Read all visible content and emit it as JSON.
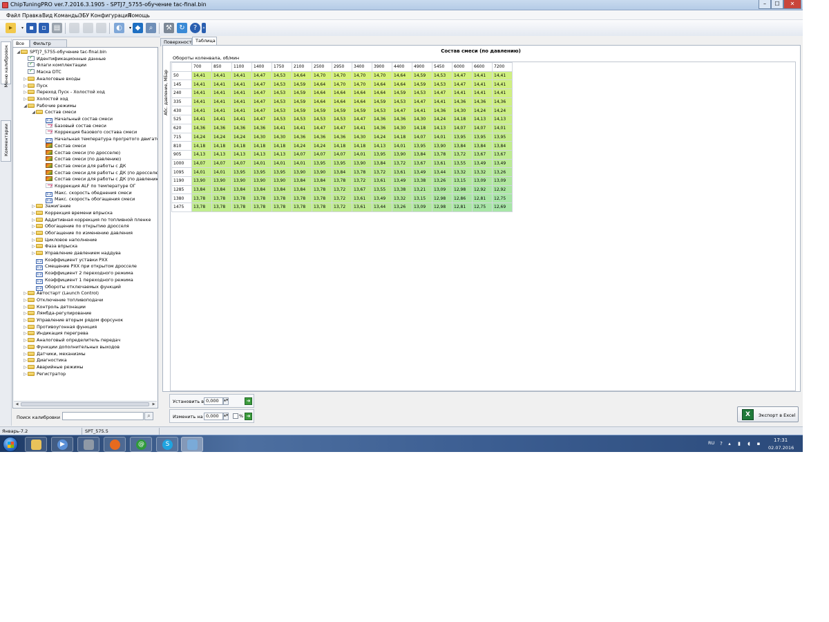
{
  "window": {
    "title": "ChipTuningPRO ver.7.2016.3.1905 - SPTJ7_5755-обучение  tac-final.bin",
    "min_glyph": "–",
    "max_glyph": "☐",
    "close_glyph": "✕"
  },
  "menu": [
    "Файл",
    "Правка",
    "Вид",
    "Команды",
    "ЭБУ",
    "Конфигурация",
    "Помощь"
  ],
  "sidetabs": {
    "menu": "Меню калибровок",
    "comments": "Комментарии"
  },
  "lefttabs": {
    "all": "Все",
    "filter": "Фильтр"
  },
  "tree": [
    {
      "label": "SPTJ7_5755-обучение  tac-final.bin",
      "level": 0,
      "icon": "folder",
      "exp": "◢"
    },
    {
      "label": "Идентификационные данные",
      "level": 1,
      "icon": "doc-check",
      "exp": ""
    },
    {
      "label": "Флаги комплектации",
      "level": 1,
      "icon": "doc-check",
      "exp": ""
    },
    {
      "label": "Маска DTC",
      "level": 1,
      "icon": "doc-check",
      "exp": ""
    },
    {
      "label": "Аналоговые входы",
      "level": 1,
      "icon": "folder",
      "exp": "▷"
    },
    {
      "label": "Пуск",
      "level": 1,
      "icon": "folder",
      "exp": "▷"
    },
    {
      "label": "Переход Пуск - Холостой ход",
      "level": 1,
      "icon": "folder",
      "exp": "▷"
    },
    {
      "label": "Холостой ход",
      "level": 1,
      "icon": "folder",
      "exp": "▷"
    },
    {
      "label": "Рабочие режимы",
      "level": 1,
      "icon": "folder",
      "exp": "◢"
    },
    {
      "label": "Состав смеси",
      "level": 2,
      "icon": "folder",
      "exp": "◢"
    },
    {
      "label": "Начальный состав смеси",
      "level": 3,
      "icon": "num",
      "exp": ""
    },
    {
      "label": "Базовый состав смеси",
      "level": 3,
      "icon": "curve",
      "exp": ""
    },
    {
      "label": "Коррекция базового состава смеси",
      "level": 3,
      "icon": "curve",
      "exp": ""
    },
    {
      "label": "Начальная температура прогретого двигателя",
      "level": 3,
      "icon": "num",
      "exp": ""
    },
    {
      "label": "Состав смеси",
      "level": 3,
      "icon": "map3d",
      "exp": ""
    },
    {
      "label": "Состав смеси (по дросселю)",
      "level": 3,
      "icon": "map3d",
      "exp": ""
    },
    {
      "label": "Состав смеси (по давлению)",
      "level": 3,
      "icon": "map3d",
      "exp": ""
    },
    {
      "label": "Состав смеси для работы с ДК",
      "level": 3,
      "icon": "map3d",
      "exp": ""
    },
    {
      "label": "Состав смеси для работы с ДК (по дросселю)",
      "level": 3,
      "icon": "map3d",
      "exp": ""
    },
    {
      "label": "Состав смеси для работы с ДК (по давлению)",
      "level": 3,
      "icon": "map3d",
      "exp": ""
    },
    {
      "label": "Коррекция ALF по температуре ОГ",
      "level": 3,
      "icon": "curve",
      "exp": ""
    },
    {
      "label": "Макс. скорость обеднения смеси",
      "level": 3,
      "icon": "num",
      "exp": ""
    },
    {
      "label": "Макс. скорость обогащения смеси",
      "level": 3,
      "icon": "num",
      "exp": ""
    },
    {
      "label": "Зажигание",
      "level": 2,
      "icon": "folder",
      "exp": "▷"
    },
    {
      "label": "Коррекция времени впрыска",
      "level": 2,
      "icon": "folder",
      "exp": "▷"
    },
    {
      "label": "Аддитивная коррекция по топливной пленке",
      "level": 2,
      "icon": "folder",
      "exp": "▷"
    },
    {
      "label": "Обогащение по открытию дросселя",
      "level": 2,
      "icon": "folder",
      "exp": "▷"
    },
    {
      "label": "Обогащение по изменению давления",
      "level": 2,
      "icon": "folder",
      "exp": "▷"
    },
    {
      "label": "Цикловое наполнение",
      "level": 2,
      "icon": "folder",
      "exp": "▷"
    },
    {
      "label": "Фаза впрыска",
      "level": 2,
      "icon": "folder",
      "exp": "▷"
    },
    {
      "label": "Управление давлением наддува",
      "level": 2,
      "icon": "folder",
      "exp": "▷"
    },
    {
      "label": "Коэффициент уставки РХХ",
      "level": 2,
      "icon": "num",
      "exp": ""
    },
    {
      "label": "Смещение РХХ при открытом дросселе",
      "level": 2,
      "icon": "num",
      "exp": ""
    },
    {
      "label": "Коэффициент 2 переходного режима",
      "level": 2,
      "icon": "num",
      "exp": ""
    },
    {
      "label": "Коэффициент 1 переходного режима",
      "level": 2,
      "icon": "num",
      "exp": ""
    },
    {
      "label": "Обороты отключаемых функций",
      "level": 2,
      "icon": "num",
      "exp": ""
    },
    {
      "label": "Автостарт (Launch Control)",
      "level": 1,
      "icon": "folder",
      "exp": "▷"
    },
    {
      "label": "Отключение топливоподачи",
      "level": 1,
      "icon": "folder",
      "exp": "▷"
    },
    {
      "label": "Контроль детонации",
      "level": 1,
      "icon": "folder",
      "exp": "▷"
    },
    {
      "label": "Лямбда-регулирование",
      "level": 1,
      "icon": "folder",
      "exp": "▷"
    },
    {
      "label": "Управление вторым рядом форсунок",
      "level": 1,
      "icon": "folder",
      "exp": "▷"
    },
    {
      "label": "Противоугонная функция",
      "level": 1,
      "icon": "folder",
      "exp": "▷"
    },
    {
      "label": "Индикация перегрева",
      "level": 1,
      "icon": "folder",
      "exp": "▷"
    },
    {
      "label": "Аналоговый определитель передач",
      "level": 1,
      "icon": "folder",
      "exp": "▷"
    },
    {
      "label": "Функции дополнительных выходов",
      "level": 1,
      "icon": "folder",
      "exp": "▷"
    },
    {
      "label": "Датчики, механизмы",
      "level": 1,
      "icon": "folder",
      "exp": "▷"
    },
    {
      "label": "Диагностика",
      "level": 1,
      "icon": "folder",
      "exp": "▷"
    },
    {
      "label": "Аварийные режимы",
      "level": 1,
      "icon": "folder",
      "exp": "▷"
    },
    {
      "label": "Регистратор",
      "level": 1,
      "icon": "folder",
      "exp": "▷"
    }
  ],
  "search": {
    "label": "Поиск калибровки",
    "value": "",
    "button_glyph": "⌕"
  },
  "righttabs": {
    "surface": "Поверхность",
    "table": "Таблица"
  },
  "table": {
    "title": "Состав смеси (по давлению)",
    "x_label": "Обороты коленвала, об/мин",
    "y_label": "Абс. давление, МБар",
    "columns": [
      "700",
      "850",
      "1100",
      "1400",
      "1750",
      "2100",
      "2500",
      "2950",
      "3400",
      "3900",
      "4400",
      "4900",
      "5450",
      "6000",
      "6600",
      "7200"
    ],
    "rows": [
      {
        "label": "50",
        "values": [
          "14,41",
          "14,41",
          "14,41",
          "14,47",
          "14,53",
          "14,64",
          "14,70",
          "14,70",
          "14,70",
          "14,70",
          "14,64",
          "14,59",
          "14,53",
          "14,47",
          "14,41",
          "14,41"
        ]
      },
      {
        "label": "145",
        "values": [
          "14,41",
          "14,41",
          "14,41",
          "14,47",
          "14,53",
          "14,59",
          "14,64",
          "14,70",
          "14,70",
          "14,64",
          "14,64",
          "14,59",
          "14,53",
          "14,47",
          "14,41",
          "14,41"
        ]
      },
      {
        "label": "240",
        "values": [
          "14,41",
          "14,41",
          "14,41",
          "14,47",
          "14,53",
          "14,59",
          "14,64",
          "14,64",
          "14,64",
          "14,64",
          "14,59",
          "14,53",
          "14,47",
          "14,41",
          "14,41",
          "14,41"
        ]
      },
      {
        "label": "335",
        "values": [
          "14,41",
          "14,41",
          "14,41",
          "14,47",
          "14,53",
          "14,59",
          "14,64",
          "14,64",
          "14,64",
          "14,59",
          "14,53",
          "14,47",
          "14,41",
          "14,36",
          "14,36",
          "14,36"
        ]
      },
      {
        "label": "430",
        "values": [
          "14,41",
          "14,41",
          "14,41",
          "14,47",
          "14,53",
          "14,59",
          "14,59",
          "14,59",
          "14,59",
          "14,53",
          "14,47",
          "14,41",
          "14,36",
          "14,30",
          "14,24",
          "14,24"
        ]
      },
      {
        "label": "525",
        "values": [
          "14,41",
          "14,41",
          "14,41",
          "14,47",
          "14,53",
          "14,53",
          "14,53",
          "14,53",
          "14,47",
          "14,36",
          "14,36",
          "14,30",
          "14,24",
          "14,18",
          "14,13",
          "14,13"
        ]
      },
      {
        "label": "620",
        "values": [
          "14,36",
          "14,36",
          "14,36",
          "14,36",
          "14,41",
          "14,41",
          "14,47",
          "14,47",
          "14,41",
          "14,36",
          "14,30",
          "14,18",
          "14,13",
          "14,07",
          "14,07",
          "14,01"
        ]
      },
      {
        "label": "715",
        "values": [
          "14,24",
          "14,24",
          "14,24",
          "14,30",
          "14,30",
          "14,36",
          "14,36",
          "14,36",
          "14,30",
          "14,24",
          "14,18",
          "14,07",
          "14,01",
          "13,95",
          "13,95",
          "13,95"
        ]
      },
      {
        "label": "810",
        "values": [
          "14,18",
          "14,18",
          "14,18",
          "14,18",
          "14,18",
          "14,24",
          "14,24",
          "14,18",
          "14,18",
          "14,13",
          "14,01",
          "13,95",
          "13,90",
          "13,84",
          "13,84",
          "13,84"
        ]
      },
      {
        "label": "905",
        "values": [
          "14,13",
          "14,13",
          "14,13",
          "14,13",
          "14,13",
          "14,07",
          "14,07",
          "14,07",
          "14,01",
          "13,95",
          "13,90",
          "13,84",
          "13,78",
          "13,72",
          "13,67",
          "13,67"
        ]
      },
      {
        "label": "1000",
        "values": [
          "14,07",
          "14,07",
          "14,07",
          "14,01",
          "14,01",
          "14,01",
          "13,95",
          "13,95",
          "13,90",
          "13,84",
          "13,72",
          "13,67",
          "13,61",
          "13,55",
          "13,49",
          "13,49"
        ]
      },
      {
        "label": "1095",
        "values": [
          "14,01",
          "14,01",
          "13,95",
          "13,95",
          "13,95",
          "13,90",
          "13,90",
          "13,84",
          "13,78",
          "13,72",
          "13,61",
          "13,49",
          "13,44",
          "13,32",
          "13,32",
          "13,26"
        ]
      },
      {
        "label": "1190",
        "values": [
          "13,90",
          "13,90",
          "13,90",
          "13,90",
          "13,90",
          "13,84",
          "13,84",
          "13,78",
          "13,72",
          "13,61",
          "13,49",
          "13,38",
          "13,26",
          "13,15",
          "13,09",
          "13,09"
        ]
      },
      {
        "label": "1285",
        "values": [
          "13,84",
          "13,84",
          "13,84",
          "13,84",
          "13,84",
          "13,84",
          "13,78",
          "13,72",
          "13,67",
          "13,55",
          "13,38",
          "13,21",
          "13,09",
          "12,98",
          "12,92",
          "12,92"
        ]
      },
      {
        "label": "1380",
        "values": [
          "13,78",
          "13,78",
          "13,78",
          "13,78",
          "13,78",
          "13,78",
          "13,78",
          "13,72",
          "13,61",
          "13,49",
          "13,32",
          "13,15",
          "12,98",
          "12,86",
          "12,81",
          "12,75"
        ]
      },
      {
        "label": "1475",
        "values": [
          "13,78",
          "13,78",
          "13,78",
          "13,78",
          "13,78",
          "13,78",
          "13,78",
          "13,72",
          "13,61",
          "13,44",
          "13,26",
          "13,09",
          "12,98",
          "12,81",
          "12,75",
          "12,69"
        ]
      }
    ],
    "cell_color_high": "#d7f27a",
    "cell_color_low": "#a8e6a8"
  },
  "controls": {
    "set_label": "Установить в",
    "set_value": "0,000",
    "change_label": "Изменить на",
    "change_value": "0,000",
    "percent_label": "%",
    "spin_glyph": "▲▼",
    "go_glyph": "➜"
  },
  "excel_button": {
    "label": "Экспорт в Excel",
    "icon_glyph": "X"
  },
  "statusbar": {
    "left": "Январь-7.2",
    "middle": "SPT_575.5"
  },
  "taskbar": {
    "lang": "RU",
    "time": "17:31",
    "date": "02.07.2016"
  },
  "colors": {
    "accent": "#2a6bc3",
    "excel_green": "#1f7a3a"
  }
}
